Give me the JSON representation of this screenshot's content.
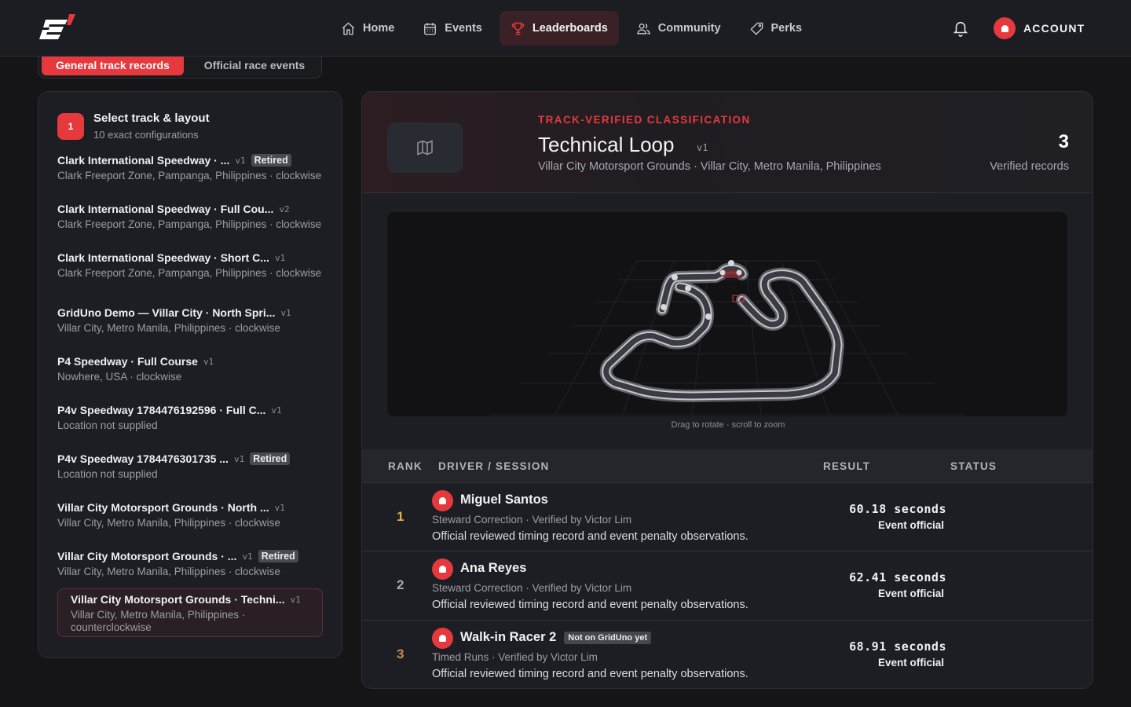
{
  "brand": {
    "logo_icon": "gridgames-logo-icon",
    "accent": "#e5393d"
  },
  "nav": {
    "items": [
      {
        "label": "Home",
        "icon": "home-icon"
      },
      {
        "label": "Events",
        "icon": "calendar-icon"
      },
      {
        "label": "Leaderboards",
        "icon": "trophy-icon",
        "active": true
      },
      {
        "label": "Community",
        "icon": "users-icon"
      },
      {
        "label": "Perks",
        "icon": "tag-icon"
      }
    ],
    "notifications_icon": "bell-icon",
    "account_label": "ACCOUNT"
  },
  "tabs": [
    {
      "label": "General track records",
      "active": true
    },
    {
      "label": "Official race events",
      "active": false
    }
  ],
  "selector": {
    "step": "1",
    "title": "Select track & layout",
    "subtitle": "10 exact configurations",
    "tracks": [
      {
        "name": "Clark International Speedway · ...",
        "version": "v1",
        "badge": "Retired",
        "meta": "Clark Freeport Zone, Pampanga, Philippines · clockwise"
      },
      {
        "name": "Clark International Speedway · Full Cou...",
        "version": "v2",
        "badge": "",
        "meta": "Clark Freeport Zone, Pampanga, Philippines · clockwise"
      },
      {
        "name": "Clark International Speedway · Short C...",
        "version": "v1",
        "badge": "",
        "meta": "Clark Freeport Zone, Pampanga, Philippines · clockwise"
      },
      {
        "name": "GridUno Demo — Villar City · North Spri...",
        "version": "v1",
        "badge": "",
        "meta": "Villar City, Metro Manila, Philippines · clockwise"
      },
      {
        "name": "P4 Speedway · Full Course",
        "version": "v1",
        "badge": "",
        "meta": "Nowhere, USA · clockwise"
      },
      {
        "name": "P4v Speedway 1784476192596 · Full C...",
        "version": "v1",
        "badge": "",
        "meta": "Location not supplied"
      },
      {
        "name": "P4v Speedway 1784476301735 ...",
        "version": "v1",
        "badge": "Retired",
        "meta": "Location not supplied"
      },
      {
        "name": "Villar City Motorsport Grounds · North ...",
        "version": "v1",
        "badge": "",
        "meta": "Villar City, Metro Manila, Philippines · clockwise"
      },
      {
        "name": "Villar City Motorsport Grounds · ...",
        "version": "v1",
        "badge": "Retired",
        "meta": "Villar City, Metro Manila, Philippines · clockwise"
      },
      {
        "name": "Villar City Motorsport Grounds · Techni...",
        "version": "v1",
        "badge": "",
        "meta": "Villar City, Metro Manila, Philippines · counterclockwise",
        "selected": true
      }
    ]
  },
  "track_detail": {
    "eyebrow": "TRACK-VERIFIED CLASSIFICATION",
    "title": "Technical Loop",
    "version": "v1",
    "location": "Villar City Motorsport Grounds · Villar City, Metro Manila, Philippines",
    "record_count": "3",
    "record_count_label": "Verified records",
    "map_icon": "map-icon",
    "viewer_hint": "Drag to rotate · scroll to zoom"
  },
  "leaderboard": {
    "columns": {
      "rank": "RANK",
      "driver": "DRIVER / SESSION",
      "result": "RESULT",
      "status": "STATUS"
    },
    "rows": [
      {
        "rank": "1",
        "rank_color": "#e0b24a",
        "driver": "Miguel Santos",
        "pill": "",
        "session": "Steward Correction · Verified by Victor Lim",
        "note": "Official reviewed timing record and event penalty observations.",
        "result": "60.18 seconds",
        "status": "Event official"
      },
      {
        "rank": "2",
        "rank_color": "#a9aab3",
        "driver": "Ana Reyes",
        "pill": "",
        "session": "Steward Correction · Verified by Victor Lim",
        "note": "Official reviewed timing record and event penalty observations.",
        "result": "62.41 seconds",
        "status": "Event official"
      },
      {
        "rank": "3",
        "rank_color": "#c98a4c",
        "driver": "Walk-in Racer 2",
        "pill": "Not on GridUno yet",
        "session": "Timed Runs · Verified by Victor Lim",
        "note": "Official reviewed timing record and event penalty observations.",
        "result": "68.91 seconds",
        "status": "Event official"
      }
    ]
  }
}
